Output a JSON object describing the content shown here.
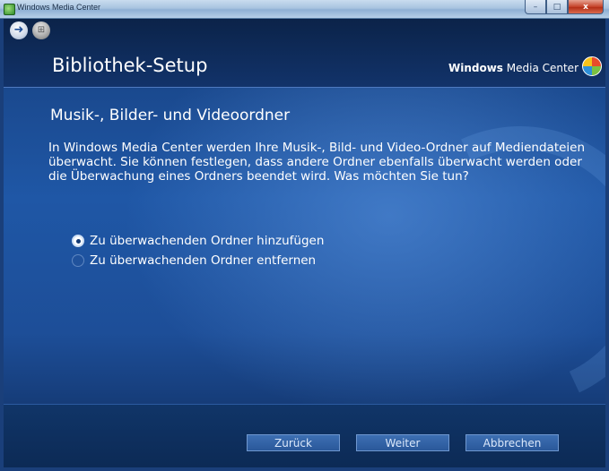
{
  "window": {
    "title": "Windows Media Center",
    "buttons": {
      "minimize": "–",
      "maximize": "□",
      "close": "x"
    }
  },
  "nav": {
    "back_glyph": "➜",
    "start_glyph": "⊞"
  },
  "header": {
    "title": "Bibliothek-Setup",
    "brand": "Windows Media Center",
    "brand_bold": "Windows",
    "brand_rest": " Media Center"
  },
  "content": {
    "heading": "Musik-, Bilder- und Videoordner",
    "description": "In Windows Media Center werden Ihre Musik-, Bild- und Video-Ordner auf Mediendateien überwacht. Sie können festlegen, dass andere Ordner ebenfalls überwacht werden oder die Überwachung eines Ordners beendet wird. Was möchten Sie tun?",
    "options": [
      {
        "label": "Zu überwachenden Ordner hinzufügen",
        "selected": true
      },
      {
        "label": "Zu überwachenden Ordner entfernen",
        "selected": false
      }
    ]
  },
  "footer": {
    "back_label": "Zurück",
    "next_label": "Weiter",
    "cancel_label": "Abbrechen"
  },
  "colors": {
    "background": "#1d4e98",
    "text": "#ffffff",
    "button": "#2a589a"
  }
}
